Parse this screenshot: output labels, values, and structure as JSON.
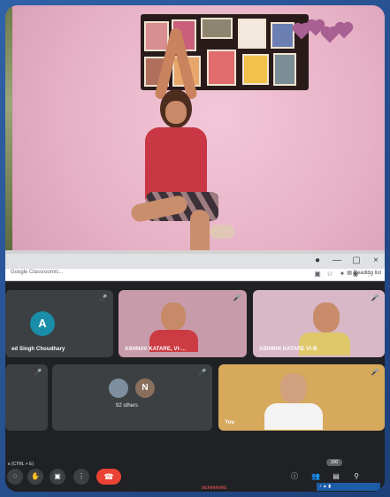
{
  "browser": {
    "tab_label": "Google Classroom/c...",
    "reading_list_label": "Reading list"
  },
  "meeting": {
    "participants": [
      {
        "name": "ed Singh Choudhary",
        "avatar_letter": "A"
      },
      {
        "name": "ASHNAV KATARE, VI-…"
      },
      {
        "name": "ASHWIN KATARE VI-B"
      },
      {
        "name": "You"
      }
    ],
    "others": {
      "avatar_letter": "N",
      "label": "92 others"
    }
  },
  "controls": {
    "shortcut_hint": "s (CTRL + E)",
    "participant_count": "100"
  },
  "watermark": {
    "text": "screenrec"
  },
  "colors": {
    "frame_blue": "#2f62a8",
    "meet_background": "#202124",
    "tile_background": "#3c4043",
    "avatar_a": "#1a8da8",
    "avatar_n": "#8a6f5d",
    "leave_red": "#ea4335"
  },
  "icons": {
    "minimize": "minimize-icon",
    "maximize": "maximize-icon",
    "close": "close-icon",
    "mic": "mic-icon",
    "leave": "phone-hangup-icon",
    "raise_hand": "hand-icon",
    "present": "present-icon",
    "more": "more-icon",
    "info": "info-icon",
    "people": "people-icon",
    "chat": "chat-icon"
  }
}
